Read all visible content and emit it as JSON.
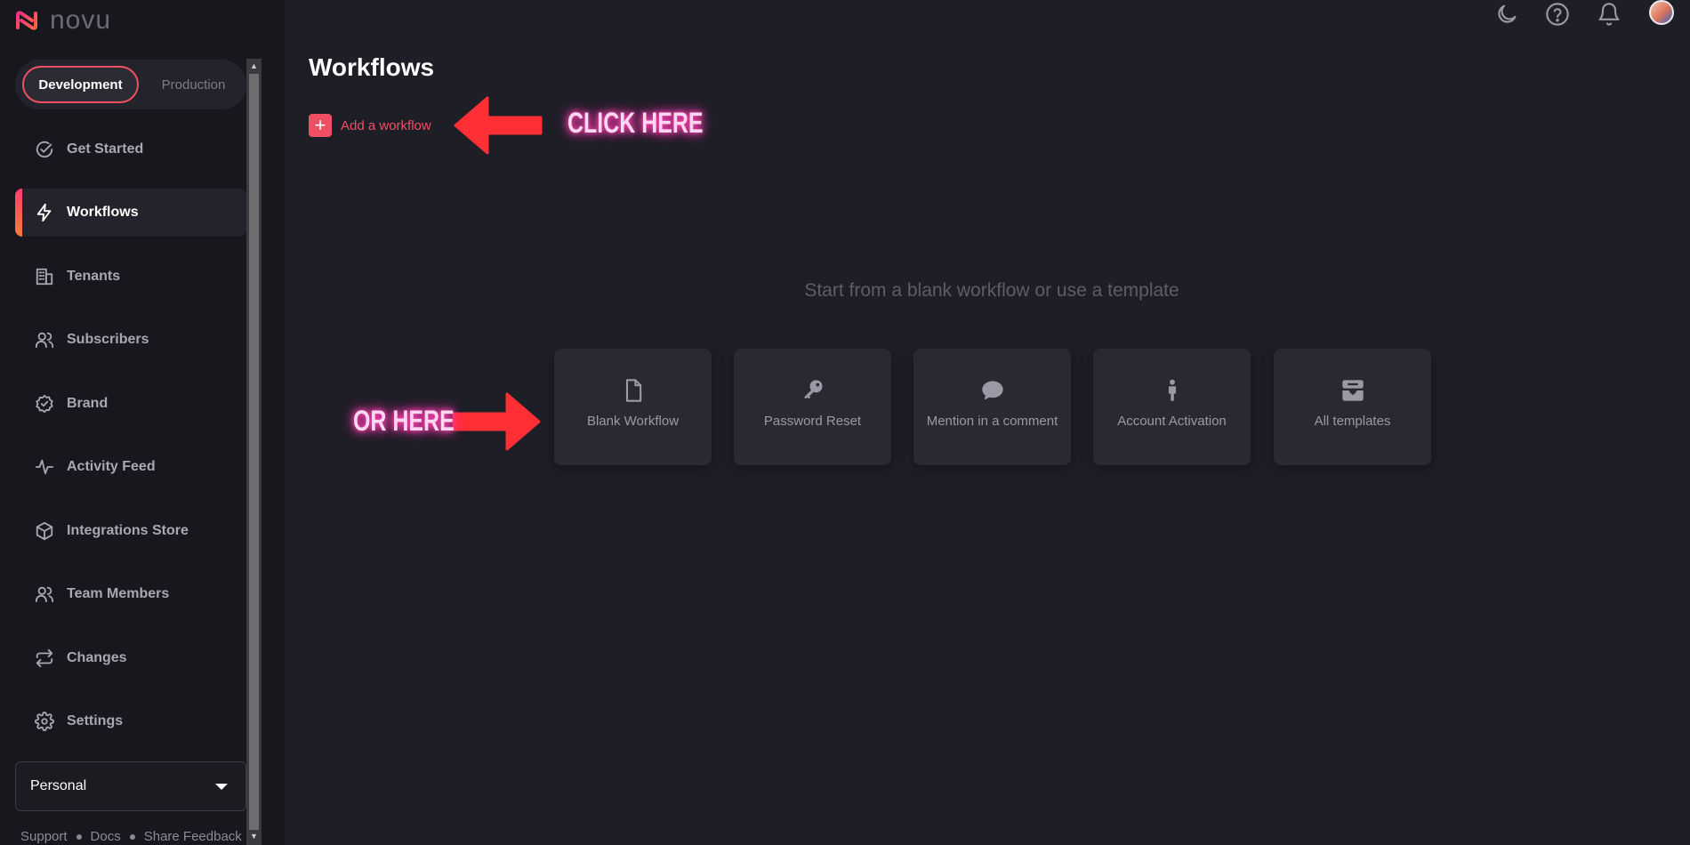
{
  "app": {
    "logo_text": "novu"
  },
  "env": {
    "dev_label": "Development",
    "prod_label": "Production"
  },
  "sidebar": {
    "items": [
      {
        "label": "Get Started",
        "icon": "check-circle-icon"
      },
      {
        "label": "Workflows",
        "icon": "lightning-icon",
        "active": true
      },
      {
        "label": "Tenants",
        "icon": "building-icon"
      },
      {
        "label": "Subscribers",
        "icon": "users-icon"
      },
      {
        "label": "Brand",
        "icon": "badge-check-icon"
      },
      {
        "label": "Activity Feed",
        "icon": "activity-icon"
      },
      {
        "label": "Integrations Store",
        "icon": "box-icon"
      },
      {
        "label": "Team Members",
        "icon": "team-icon"
      },
      {
        "label": "Changes",
        "icon": "repeat-icon"
      },
      {
        "label": "Settings",
        "icon": "gear-icon"
      }
    ],
    "org_select": {
      "value": "Personal"
    },
    "footer": {
      "support": "Support",
      "docs": "Docs",
      "feedback": "Share Feedback"
    }
  },
  "header": {
    "icons": [
      "moon-icon",
      "help-icon",
      "bell-icon",
      "avatar"
    ]
  },
  "main": {
    "title": "Workflows",
    "add_label": "Add a workflow",
    "subtitle": "Start from a blank workflow or use a template",
    "templates": [
      {
        "label": "Blank Workflow",
        "icon": "file-icon"
      },
      {
        "label": "Password Reset",
        "icon": "key-icon"
      },
      {
        "label": "Mention in a comment",
        "icon": "chat-icon"
      },
      {
        "label": "Account Activation",
        "icon": "person-icon"
      },
      {
        "label": "All templates",
        "icon": "inbox-icon"
      }
    ]
  },
  "annotations": {
    "click_here": "CLICK HERE",
    "or_here": "OR HERE"
  },
  "colors": {
    "accent": "#ef4f63",
    "annotation_arrow": "#ff2f35",
    "annotation_glow": "#ff3fb0",
    "background": "#1e1e26",
    "sidebar": "#17171d"
  }
}
